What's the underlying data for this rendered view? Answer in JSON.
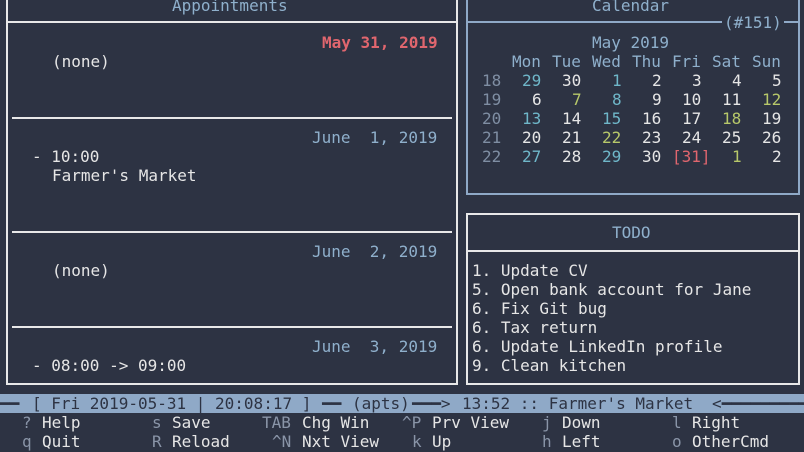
{
  "appointments": {
    "title": "Appointments",
    "days": [
      {
        "date": "May 31, 2019",
        "items": [
          {
            "time": "",
            "text": "(none)"
          }
        ]
      },
      {
        "date": "June  1, 2019",
        "items": [
          {
            "time": "- 10:00",
            "text": "Farmer's Market"
          }
        ]
      },
      {
        "date": "June  2, 2019",
        "items": [
          {
            "time": "",
            "text": "(none)"
          }
        ]
      },
      {
        "date": "June  3, 2019",
        "items": [
          {
            "time": "- 08:00 -> 09:00",
            "text": ""
          }
        ]
      }
    ]
  },
  "calendar": {
    "title": "Calendar",
    "week_tag": "(#151)",
    "month_label": "May 2019",
    "weekdays": [
      "Mon",
      "Tue",
      "Wed",
      "Thu",
      "Fri",
      "Sat",
      "Sun"
    ],
    "weeks": [
      {
        "num": "18",
        "days": [
          "29",
          "30",
          "1",
          "2",
          "3",
          "4",
          "5"
        ]
      },
      {
        "num": "19",
        "days": [
          "6",
          "7",
          "8",
          "9",
          "10",
          "11",
          "12"
        ]
      },
      {
        "num": "20",
        "days": [
          "13",
          "14",
          "15",
          "16",
          "17",
          "18",
          "19"
        ]
      },
      {
        "num": "21",
        "days": [
          "20",
          "21",
          "22",
          "23",
          "24",
          "25",
          "26"
        ]
      },
      {
        "num": "22",
        "days": [
          "27",
          "28",
          "29",
          "30",
          "[31]",
          "1",
          "2"
        ]
      }
    ]
  },
  "todo": {
    "title": "TODO",
    "items": [
      "1. Update CV",
      "5. Open bank account for Jane",
      "6. Fix Git bug",
      "6. Tax return",
      "6. Update LinkedIn profile",
      "9. Clean kitchen"
    ]
  },
  "status_bar": {
    "datetime": "[ Fri 2019-05-31 | 20:08:17 ]",
    "mode": "(apts)",
    "next_appt": "13:52 :: Farmer's Market"
  },
  "help": {
    "row1": [
      {
        "key": "?",
        "label": "Help"
      },
      {
        "key": "s",
        "label": "Save"
      },
      {
        "key": "TAB",
        "label": "Chg Win"
      },
      {
        "key": "^P",
        "label": "Prv View"
      },
      {
        "key": "j",
        "label": "Down"
      },
      {
        "key": "l",
        "label": "Right"
      }
    ],
    "row2": [
      {
        "key": "q",
        "label": "Quit"
      },
      {
        "key": "R",
        "label": "Reload"
      },
      {
        "key": "^N",
        "label": "Nxt View"
      },
      {
        "key": "k",
        "label": "Up"
      },
      {
        "key": "h",
        "label": "Left"
      },
      {
        "key": "o",
        "label": "OtherCmd"
      }
    ]
  },
  "colors": {
    "background": "#2d3343",
    "accent": "#8fa9c7",
    "today": "#e0666e",
    "weekend": "#b7c86a"
  }
}
